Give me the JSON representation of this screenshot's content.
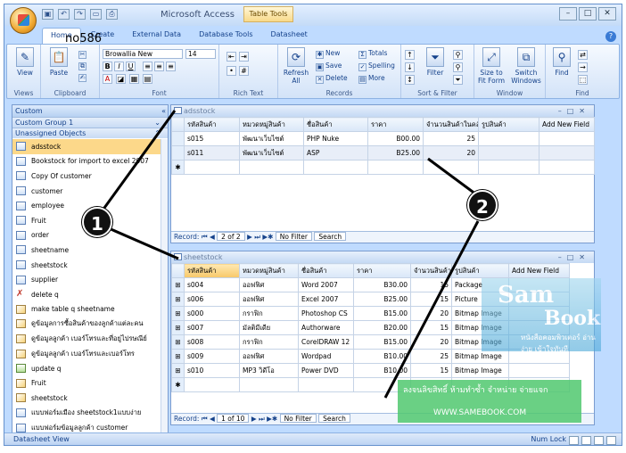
{
  "window": {
    "app_title": "Microsoft Access",
    "table_tools_label": "Table Tools",
    "help": "?",
    "controls": [
      "–",
      "□",
      "✕"
    ]
  },
  "annotation_text": "no586",
  "ribbon": {
    "tabs": [
      "Home",
      "Create",
      "External Data",
      "Database Tools",
      "Datasheet"
    ],
    "groups": {
      "views": {
        "label": "Views",
        "view": "View"
      },
      "clipboard": {
        "label": "Clipboard",
        "paste": "Paste"
      },
      "font": {
        "label": "Font",
        "font_name": "Browallia New",
        "font_size": "14",
        "bold": "B",
        "italic": "I",
        "underline": "U"
      },
      "rich_text": {
        "label": "Rich Text"
      },
      "records": {
        "label": "Records",
        "refresh": "Refresh All",
        "new": "New",
        "save": "Save",
        "delete": "Delete",
        "totals": "Totals",
        "spelling": "Spelling",
        "more": "More"
      },
      "sort_filter": {
        "label": "Sort & Filter",
        "filter": "Filter"
      },
      "window": {
        "label": "Window",
        "size_to_fit": "Size to Fit Form",
        "switch_windows": "Switch Windows"
      },
      "find": {
        "label": "Find",
        "find": "Find"
      }
    }
  },
  "nav_pane": {
    "header": "Custom",
    "groups": [
      "Custom Group 1",
      "Unassigned Objects"
    ],
    "items": [
      {
        "label": "adsstock",
        "kind": "table",
        "selected": true
      },
      {
        "label": "Bookstock for import to excel 2007",
        "kind": "table"
      },
      {
        "label": "Copy Of customer",
        "kind": "table"
      },
      {
        "label": "customer",
        "kind": "table"
      },
      {
        "label": "employee",
        "kind": "table"
      },
      {
        "label": "Fruit",
        "kind": "table"
      },
      {
        "label": "order",
        "kind": "table"
      },
      {
        "label": "sheetname",
        "kind": "table"
      },
      {
        "label": "sheetstock",
        "kind": "table"
      },
      {
        "label": "supplier",
        "kind": "table"
      },
      {
        "label": "delete q",
        "kind": "delete"
      },
      {
        "label": "make table q sheetname",
        "kind": "query"
      },
      {
        "label": "ดูข้อมูลการซื้อสินค้าของลูกค้าแต่ละคน",
        "kind": "query"
      },
      {
        "label": "ดูข้อมูลลูกค้า เบอร์โทรและที่อยู่ไปรษณีย์",
        "kind": "query"
      },
      {
        "label": "ดูข้อมูลลูกค้า เบอร์โทรและเบอร์โทร",
        "kind": "query"
      },
      {
        "label": "update q",
        "kind": "update"
      },
      {
        "label": "Fruit",
        "kind": "query"
      },
      {
        "label": "sheetstock",
        "kind": "query"
      },
      {
        "label": "แบบฟอร์มเมือง sheetstock1แบบง่าย",
        "kind": "table"
      },
      {
        "label": "แบบฟอร์มข้อมูลลูกค้า customer",
        "kind": "table"
      }
    ]
  },
  "adsstock_window": {
    "title": "adsstock",
    "headers": [
      "รหัสสินค้า",
      "หมวดหมู่สินค้า",
      "ชื่อสินค้า",
      "ราคา",
      "จำนวนสินค้าในคลัง",
      "รูปสินค้า",
      "Add New Field"
    ],
    "rows": [
      [
        "s015",
        "พัฒนาเว็บไซต์",
        "PHP Nuke",
        "B00.00",
        "25",
        ""
      ],
      [
        "s011",
        "พัฒนาเว็บไซต์",
        "ASP",
        "B25.00",
        "20",
        ""
      ]
    ],
    "new_row_marker": "✱",
    "record_nav": {
      "label": "Record:",
      "position": "2 of 2",
      "no_filter": "No Filter",
      "search": "Search"
    }
  },
  "sheetstock_window": {
    "title": "sheetstock",
    "headers": [
      "รหัสสินค้า",
      "หมวดหมู่สินค้า",
      "ชื่อสินค้า",
      "ราคา",
      "จำนวนสินค้าในคลัง",
      "รูปสินค้า",
      "Add New Field"
    ],
    "rows": [
      [
        "s004",
        "ออฟฟิศ",
        "Word 2007",
        "B30.00",
        "15",
        "Package"
      ],
      [
        "s006",
        "ออฟฟิศ",
        "Excel 2007",
        "B25.00",
        "15",
        "Picture"
      ],
      [
        "s000",
        "กราฟิก",
        "Photoshop CS",
        "B15.00",
        "20",
        "Bitmap Image"
      ],
      [
        "s007",
        "มัลติมีเดีย",
        "Authorware",
        "B20.00",
        "15",
        "Bitmap Image"
      ],
      [
        "s008",
        "กราฟิก",
        "CorelDRAW 12",
        "B15.00",
        "20",
        "Bitmap Image"
      ],
      [
        "s009",
        "ออฟฟิศ",
        "Wordpad",
        "B10.00",
        "25",
        "Bitmap Image"
      ],
      [
        "s010",
        "MP3 วิดีโอ",
        "Power DVD",
        "B10.00",
        "15",
        "Bitmap Image"
      ]
    ],
    "new_row_marker": "✱",
    "record_nav": {
      "label": "Record:",
      "position": "1 of 10",
      "no_filter": "No Filter",
      "search": "Search"
    }
  },
  "callouts": [
    "1",
    "2"
  ],
  "watermark": {
    "line1": "Sam",
    "line2": "Book",
    "tagline": "หนังสือคอมพิวเตอร์ อ่านง่าย เข้าใจทันที",
    "strip1": "ลงจนลิขสิทธิ์ ห้ามทำซ้ำ จำหน่าย จ่ายแจก",
    "strip2": "WWW.SAMEBOOK.COM"
  },
  "statusbar": {
    "left": "Datasheet View",
    "num_lock": "Num Lock"
  },
  "colors": {
    "ribbon_bg": "#d3e3f8",
    "selected_item": "#fcd88a",
    "callout": "#111111",
    "watermark": "#4aa8d8"
  }
}
